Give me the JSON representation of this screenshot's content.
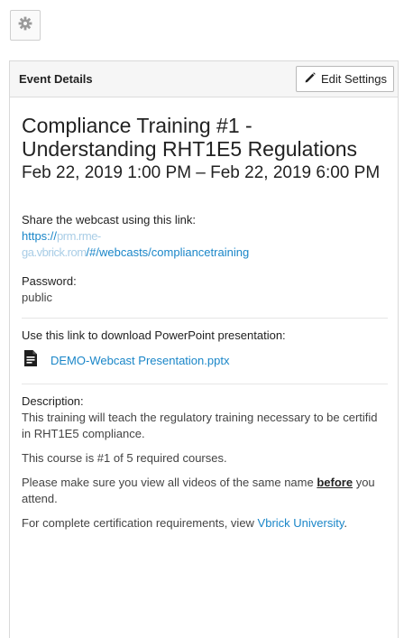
{
  "header": {
    "panel_title": "Event Details",
    "edit_label": "Edit Settings"
  },
  "event": {
    "title": "Compliance Training #1 - Understanding RHT1E5 Regulations",
    "dates": "Feb 22, 2019 1:00 PM – Feb 22, 2019 6:00 PM"
  },
  "share": {
    "label": "Share the webcast using this link:",
    "link_line1_visible": "https://",
    "link_line1_blurred": "prm.rme-",
    "link_line2_blurred": "ga.vbrick.rom",
    "link_line2_visible": "/#/webcasts/compliancetraining"
  },
  "password": {
    "label": "Password:",
    "value": "public"
  },
  "presentation": {
    "label": "Use this link to download PowerPoint presentation:",
    "file_name": "DEMO-Webcast Presentation.pptx"
  },
  "description": {
    "label": "Description:",
    "line1": "This training will teach the regulatory training necessary to be certifid in RHT1E5 compliance.",
    "line2": "This course is #1 of 5 required courses.",
    "line3_pre": "Please make sure you view all videos of the same name ",
    "line3_emph": "before",
    "line3_post": " you attend.",
    "line4_pre": "For complete certification requirements, view ",
    "line4_link": "Vbrick University",
    "line4_post": "."
  },
  "icons": [
    "gear-icon",
    "pencil-icon",
    "document-icon"
  ],
  "colors": {
    "link": "#1a86c8",
    "header_bg": "#f6f6f6",
    "border": "#d9d9d9"
  }
}
